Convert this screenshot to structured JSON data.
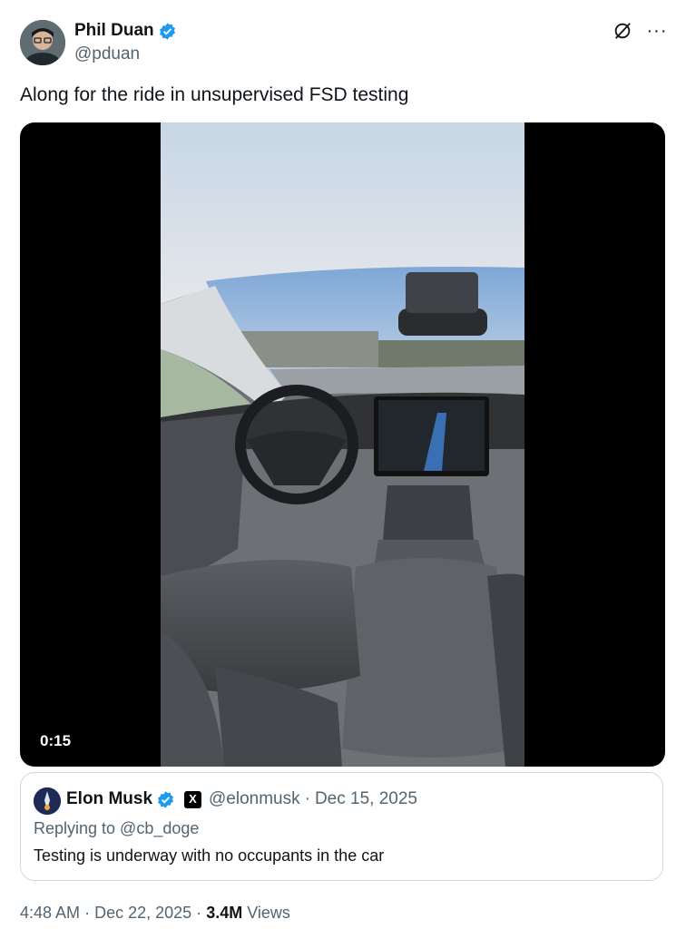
{
  "author": {
    "name": "Phil Duan",
    "handle": "@pduan",
    "verified_color": "#1d9bf0"
  },
  "post": {
    "text": "Along for the ride in unsupervised FSD testing",
    "video_duration": "0:15"
  },
  "top_icons": [
    "grok-icon",
    "more-icon"
  ],
  "more_label": "···",
  "quote": {
    "name": "Elon Musk",
    "badge_label": "X",
    "handle": "@elonmusk",
    "separator": "·",
    "date": "Dec 15, 2025",
    "replying_to": "Replying to @cb_doge",
    "text": "Testing is underway with no occupants in the car"
  },
  "footer": {
    "time": "4:48 AM",
    "separator1": "·",
    "date": "Dec 22, 2025",
    "separator2": "·",
    "views_count": "3.4M",
    "views_label": "Views"
  }
}
